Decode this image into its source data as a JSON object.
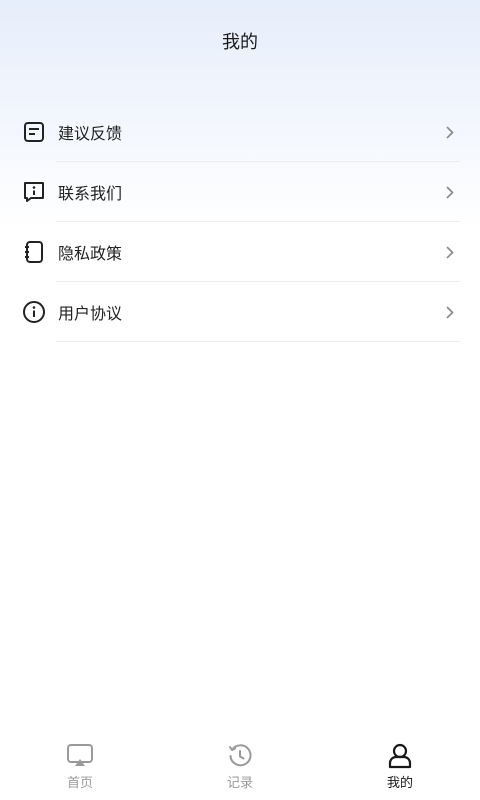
{
  "header": {
    "title": "我的"
  },
  "menu": [
    {
      "label": "建议反馈",
      "icon": "feedback-icon"
    },
    {
      "label": "联系我们",
      "icon": "contact-icon"
    },
    {
      "label": "隐私政策",
      "icon": "privacy-policy-icon"
    },
    {
      "label": "用户协议",
      "icon": "user-agreement-icon"
    }
  ],
  "tabbar": [
    {
      "label": "首页",
      "icon": "screen-cast-icon",
      "active": false
    },
    {
      "label": "记录",
      "icon": "history-icon",
      "active": false
    },
    {
      "label": "我的",
      "icon": "user-icon",
      "active": true
    }
  ],
  "colors": {
    "active": "#1a1a1a",
    "inactive": "#9a9a9a",
    "divider": "#ececec"
  }
}
